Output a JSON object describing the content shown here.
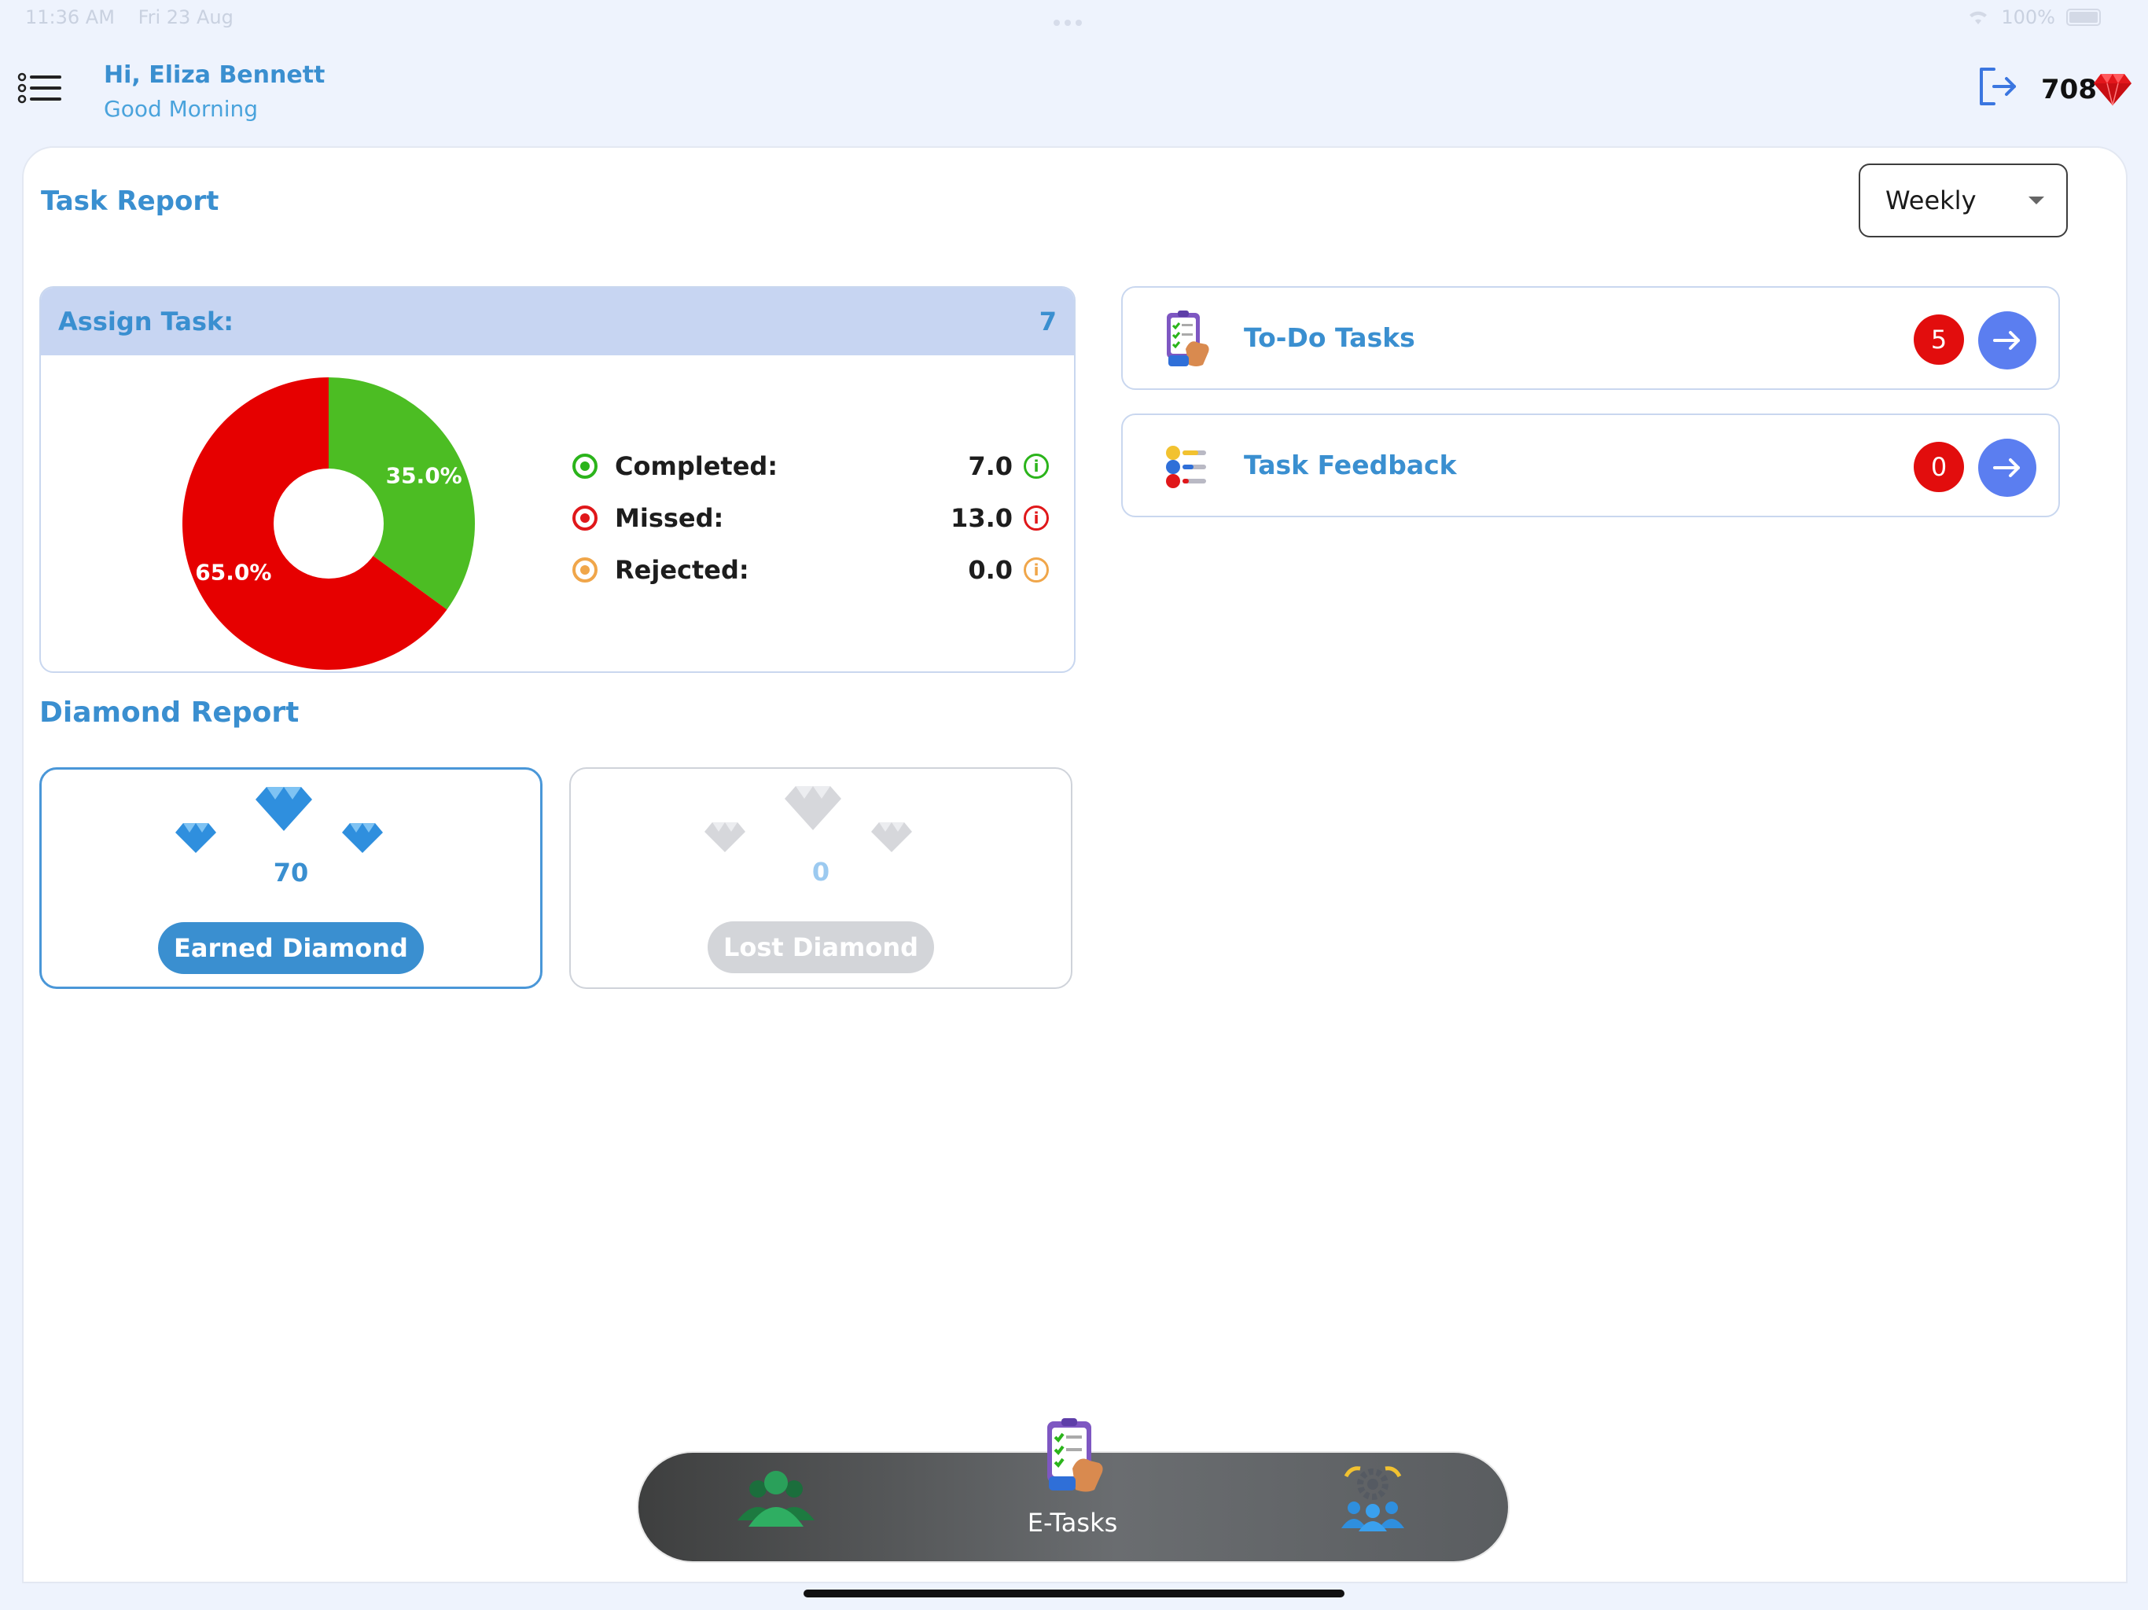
{
  "status_bar": {
    "time": "11:36 AM",
    "date": "Fri 23 Aug",
    "battery": "100%"
  },
  "header": {
    "greeting": "Hi, Eliza Bennett",
    "subgreeting": "Good Morning",
    "diamond_score": "708",
    "menu_icon": "menu-list-icon",
    "logout_icon": "logout-icon"
  },
  "task_report": {
    "title": "Task Report",
    "period_select": {
      "selected": "Weekly"
    },
    "assign_task": {
      "label": "Assign Task:",
      "count": "7",
      "legend": [
        {
          "label": "Completed:",
          "value": "7.0",
          "color": "#2bb41b"
        },
        {
          "label": "Missed:",
          "value": "13.0",
          "color": "#e0171a"
        },
        {
          "label": "Rejected:",
          "value": "0.0",
          "color": "#f0a64a"
        }
      ]
    }
  },
  "chart_data": {
    "type": "pie",
    "categories": [
      "Completed",
      "Missed"
    ],
    "values": [
      35.0,
      65.0
    ],
    "slice_labels": [
      "35.0%",
      "65.0%"
    ],
    "colors": [
      "#4cbd23",
      "#e60000"
    ],
    "donut": true
  },
  "diamond_report": {
    "title": "Diamond Report",
    "earned": {
      "count": "70",
      "label": "Earned Diamond",
      "color": "#3a8fd0"
    },
    "lost": {
      "count": "0",
      "label": "Lost Diamond",
      "color": "#d3d5d9"
    }
  },
  "tasks": [
    {
      "label": "To-Do Tasks",
      "badge": "5",
      "icon": "todo-clipboard-icon"
    },
    {
      "label": "Task Feedback",
      "badge": "0",
      "icon": "feedback-list-icon"
    }
  ],
  "bottom_nav": {
    "items": [
      {
        "icon": "people-group-icon"
      },
      {
        "label": "E-Tasks",
        "icon": "etasks-clipboard-icon"
      },
      {
        "icon": "team-settings-icon"
      }
    ]
  }
}
